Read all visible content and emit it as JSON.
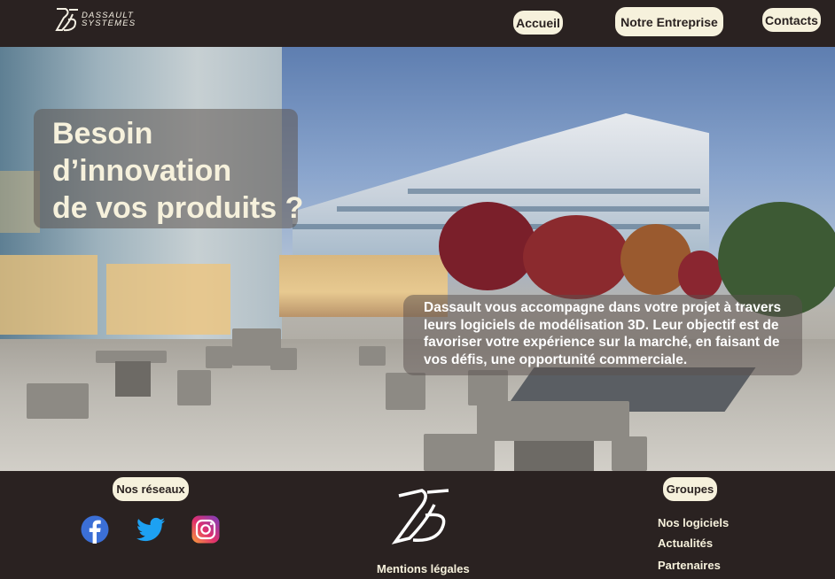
{
  "header": {
    "logo_line1": "DASSAULT",
    "logo_line2": "SYSTEMES",
    "nav": {
      "accueil": "Accueil",
      "entreprise": "Notre Entreprise",
      "contacts": "Contacts"
    }
  },
  "hero": {
    "title_line1": "Besoin",
    "title_line2": "d’innovation",
    "title_line3": "de vos produits ?",
    "description": "Dassault vous accompagne dans votre projet à travers leurs logiciels de modélisation 3D. Leur objectif est de favoriser votre expérience sur la marché, en faisant de vos défis, une opportunité commerciale."
  },
  "footer": {
    "networks_label": "Nos réseaux",
    "groups_label": "Groupes",
    "legal_link": "Mentions légales",
    "group_links": {
      "logiciels": "Nos logiciels",
      "actualites": "Actualités",
      "partenaires": "Partenaires"
    },
    "social_icons": [
      "facebook-icon",
      "twitter-icon",
      "instagram-icon"
    ]
  },
  "colors": {
    "background": "#2a2221",
    "pill": "#f6f1dc",
    "accent_text": "#f6f1dc"
  }
}
